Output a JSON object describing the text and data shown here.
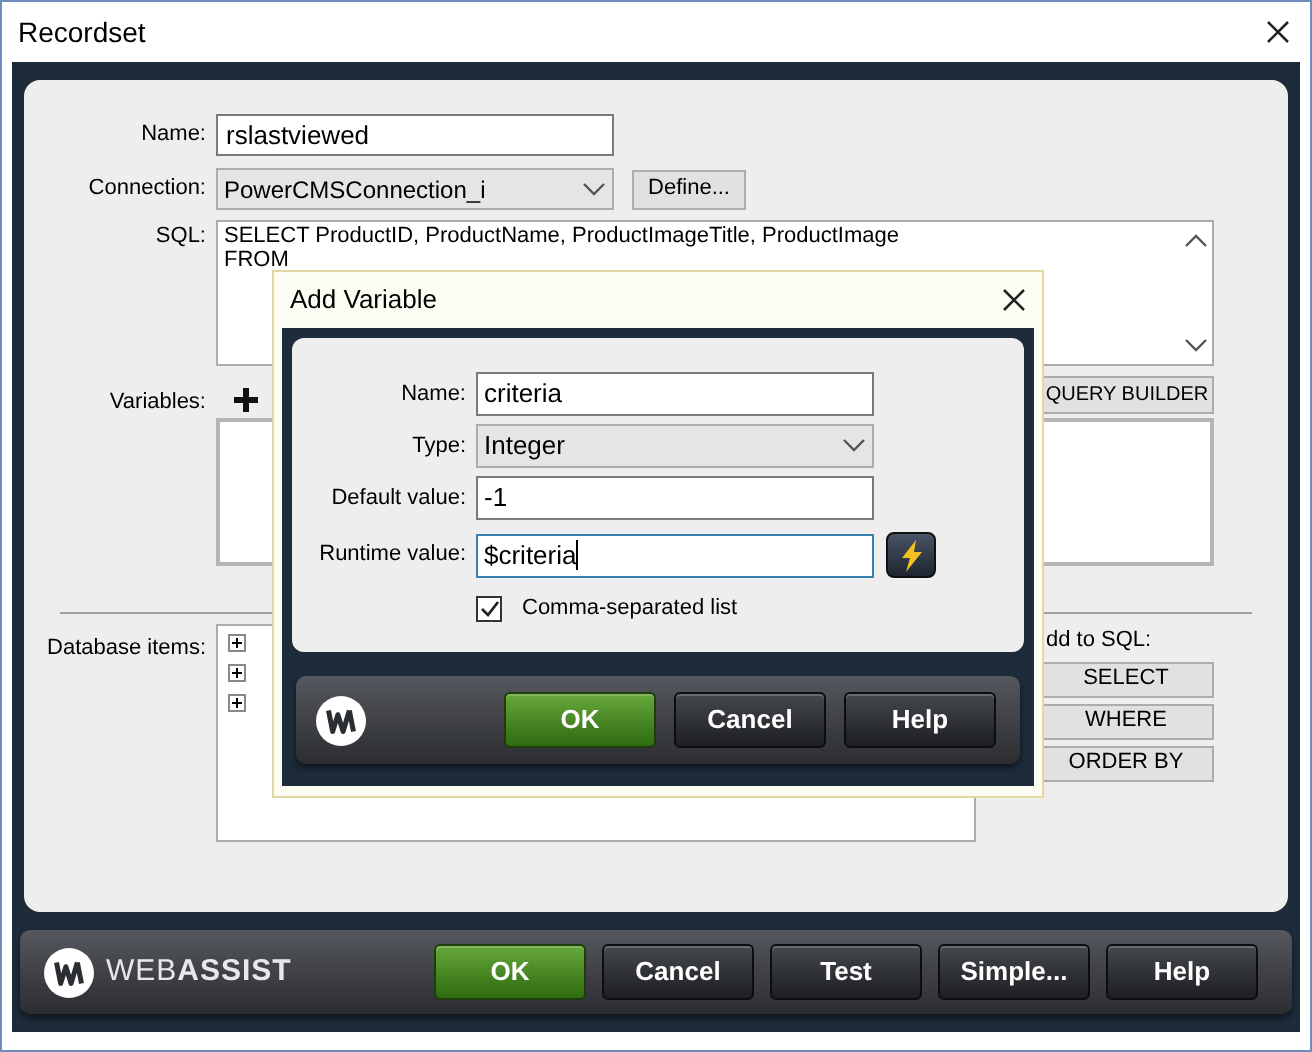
{
  "window": {
    "title": "Recordset"
  },
  "form": {
    "name": {
      "label": "Name:",
      "value": "rslastviewed"
    },
    "connection": {
      "label": "Connection:",
      "value": "PowerCMSConnection_i"
    },
    "define_button": "Define...",
    "sql": {
      "label": "SQL:",
      "lines": [
        "SELECT ProductID, ProductName, ProductImageTitle, ProductImage",
        "FROM"
      ]
    },
    "variables_label": "Variables:",
    "query_builder_button": "QUERY BUILDER",
    "database_items": {
      "label": "Database items:",
      "nodes": [
        {
          "expanded": false
        },
        {
          "expanded": false
        },
        {
          "expanded": false
        }
      ]
    },
    "add_to_sql": {
      "label": "dd to SQL:",
      "buttons": [
        "SELECT",
        "WHERE",
        "ORDER BY"
      ]
    }
  },
  "footer": {
    "brand": "WEB**ASSIST**",
    "buttons": [
      {
        "label": "OK",
        "kind": "primary"
      },
      {
        "label": "Cancel",
        "kind": "normal"
      },
      {
        "label": "Test",
        "kind": "normal"
      },
      {
        "label": "Simple...",
        "kind": "normal"
      },
      {
        "label": "Help",
        "kind": "normal"
      }
    ]
  },
  "dialog": {
    "title": "Add Variable",
    "fields": [
      {
        "label": "Name:",
        "value": "criteria",
        "kind": "text",
        "focused": false
      },
      {
        "label": "Type:",
        "value": "Integer",
        "kind": "select",
        "focused": false
      },
      {
        "label": "Default value:",
        "value": "-1",
        "kind": "text",
        "focused": false
      },
      {
        "label": "Runtime value:",
        "value": "$criteria",
        "kind": "dynamic",
        "focused": true
      }
    ],
    "checkbox": {
      "label": "Comma-separated list",
      "checked": true
    },
    "buttons": [
      {
        "label": "OK",
        "kind": "primary"
      },
      {
        "label": "Cancel",
        "kind": "normal"
      },
      {
        "label": "Help",
        "kind": "normal"
      }
    ]
  }
}
